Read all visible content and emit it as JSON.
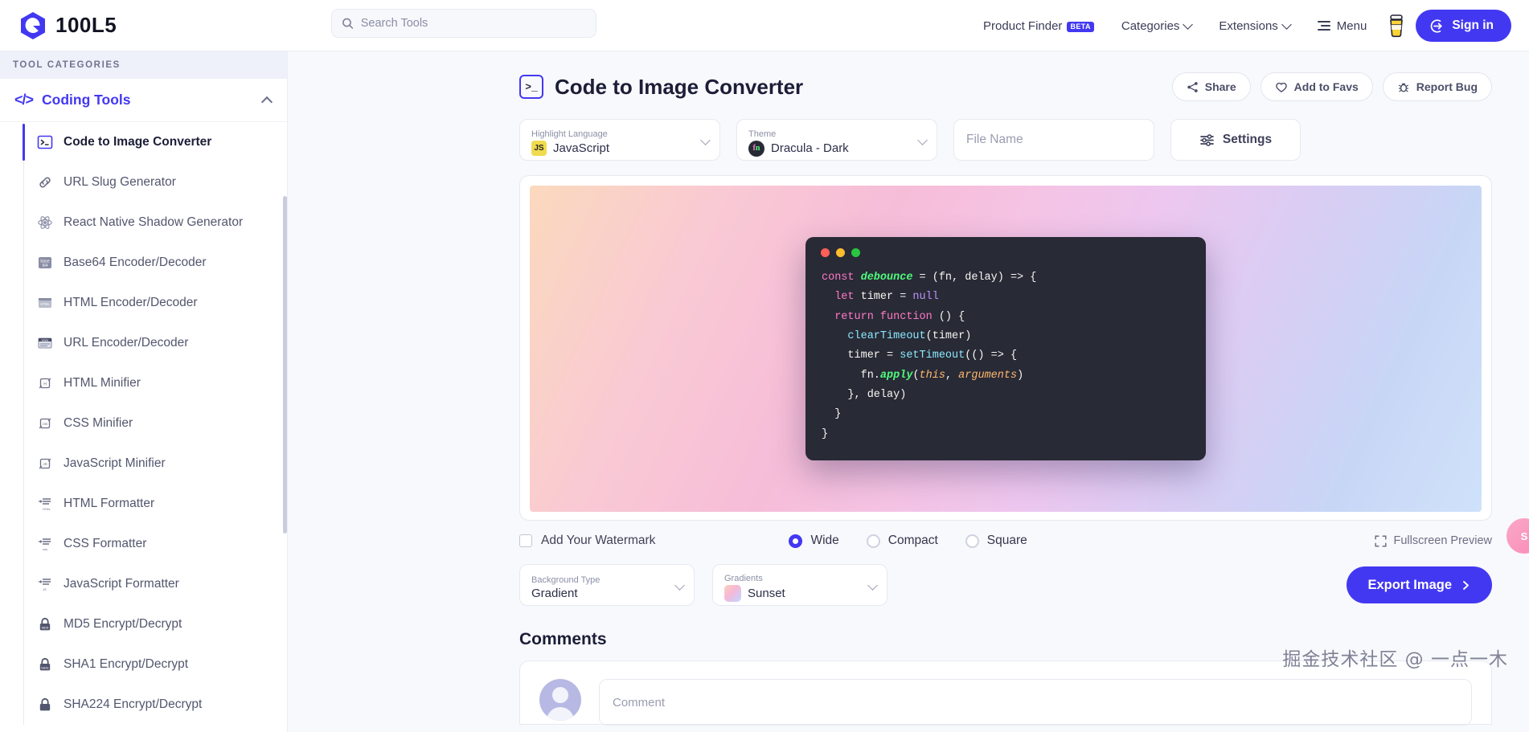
{
  "header": {
    "brand_name": "100L5",
    "logo_icon": "hexagon-logo-icon",
    "search": {
      "placeholder": "Search Tools",
      "value": "",
      "icon": "search-icon"
    },
    "nav": [
      {
        "label": "Product Finder",
        "badge": "BETA",
        "caret": false
      },
      {
        "label": "Categories",
        "badge": "",
        "caret": true
      },
      {
        "label": "Extensions",
        "badge": "",
        "caret": true
      },
      {
        "label": "Menu",
        "badge": "",
        "caret": false
      }
    ],
    "coffee_icon": "coffee-cup-icon",
    "signin_label": "Sign in",
    "signin_icon": "sign-in-icon",
    "accent_color": "#4338f2"
  },
  "sidebar": {
    "section_title": "TOOL CATEGORIES",
    "category": {
      "label": "Coding Tools",
      "icon": "code-brackets-icon",
      "expanded": true
    },
    "items": [
      {
        "label": "Code to Image Converter",
        "icon": "terminal-icon",
        "active": true
      },
      {
        "label": "URL Slug Generator",
        "icon": "link-icon",
        "active": false
      },
      {
        "label": "React Native Shadow Generator",
        "icon": "react-icon",
        "active": false
      },
      {
        "label": "Base64 Encoder/Decoder",
        "icon": "base64-icon",
        "active": false
      },
      {
        "label": "HTML Encoder/Decoder",
        "icon": "html-icon",
        "active": false
      },
      {
        "label": "URL Encoder/Decoder",
        "icon": "url-icon",
        "active": false
      },
      {
        "label": "HTML Minifier",
        "icon": "html-minify-icon",
        "active": false
      },
      {
        "label": "CSS Minifier",
        "icon": "css-minify-icon",
        "active": false
      },
      {
        "label": "JavaScript Minifier",
        "icon": "js-minify-icon",
        "active": false
      },
      {
        "label": "HTML Formatter",
        "icon": "html-format-icon",
        "active": false
      },
      {
        "label": "CSS Formatter",
        "icon": "css-format-icon",
        "active": false
      },
      {
        "label": "JavaScript Formatter",
        "icon": "js-format-icon",
        "active": false
      },
      {
        "label": "MD5 Encrypt/Decrypt",
        "icon": "lock-md5-icon",
        "active": false
      },
      {
        "label": "SHA1 Encrypt/Decrypt",
        "icon": "lock-sha1-icon",
        "active": false
      },
      {
        "label": "SHA224 Encrypt/Decrypt",
        "icon": "lock-sha224-icon",
        "active": false
      }
    ]
  },
  "page": {
    "title": "Code to Image Converter",
    "title_icon": "terminal-icon",
    "actions": [
      {
        "label": "Share",
        "icon": "share-icon"
      },
      {
        "label": "Add to Favs",
        "icon": "heart-icon"
      },
      {
        "label": "Report Bug",
        "icon": "bug-icon"
      }
    ]
  },
  "controls": {
    "language": {
      "label": "Highlight Language",
      "value": "JavaScript",
      "badge": "JS"
    },
    "theme": {
      "label": "Theme",
      "value": "Dracula - Dark",
      "badge": "fn"
    },
    "file_name": {
      "placeholder": "File Name",
      "value": ""
    },
    "settings_label": "Settings",
    "settings_icon": "sliders-icon"
  },
  "preview": {
    "code_lines": [
      [
        {
          "t": "const ",
          "c": "k"
        },
        {
          "t": "debounce",
          "c": "fn"
        },
        {
          "t": " = (fn, delay) => {",
          "c": "pl"
        }
      ],
      [
        {
          "t": "  let ",
          "c": "k"
        },
        {
          "t": "timer = ",
          "c": "pl"
        },
        {
          "t": "null",
          "c": "pu"
        }
      ],
      [
        {
          "t": "  return function",
          "c": "k"
        },
        {
          "t": " () {",
          "c": "pl"
        }
      ],
      [
        {
          "t": "    ",
          "c": "pl"
        },
        {
          "t": "clearTimeout",
          "c": "cy"
        },
        {
          "t": "(timer)",
          "c": "pl"
        }
      ],
      [
        {
          "t": "    timer = ",
          "c": "pl"
        },
        {
          "t": "setTimeout",
          "c": "cy"
        },
        {
          "t": "(() => {",
          "c": "pl"
        }
      ],
      [
        {
          "t": "      fn.",
          "c": "pl"
        },
        {
          "t": "apply",
          "c": "fn"
        },
        {
          "t": "(",
          "c": "pl"
        },
        {
          "t": "this",
          "c": "or"
        },
        {
          "t": ", ",
          "c": "pl"
        },
        {
          "t": "arguments",
          "c": "or"
        },
        {
          "t": ")",
          "c": "pl"
        }
      ],
      [
        {
          "t": "    }, delay)",
          "c": "pl"
        }
      ],
      [
        {
          "t": "  }",
          "c": "pl"
        }
      ],
      [
        {
          "t": "}",
          "c": "pl"
        }
      ]
    ],
    "window_dots": [
      "red",
      "yellow",
      "green"
    ],
    "gradient_name": "Sunset"
  },
  "options": {
    "watermark": {
      "label": "Add Your Watermark",
      "checked": false
    },
    "sizes": [
      {
        "label": "Wide",
        "selected": true
      },
      {
        "label": "Compact",
        "selected": false
      },
      {
        "label": "Square",
        "selected": false
      }
    ],
    "fullscreen": {
      "label": "Fullscreen Preview",
      "icon": "expand-icon"
    }
  },
  "bottom": {
    "background_type": {
      "label": "Background Type",
      "value": "Gradient"
    },
    "gradients": {
      "label": "Gradients",
      "value": "Sunset"
    },
    "export_label": "Export Image",
    "export_icon": "chevron-right-icon"
  },
  "comments": {
    "heading": "Comments",
    "input_placeholder": "Comment",
    "avatar_icon": "user-avatar-icon"
  },
  "overlay": {
    "watermark_text": "掘金技术社区 @ 一点一木",
    "float_badge": "S"
  }
}
